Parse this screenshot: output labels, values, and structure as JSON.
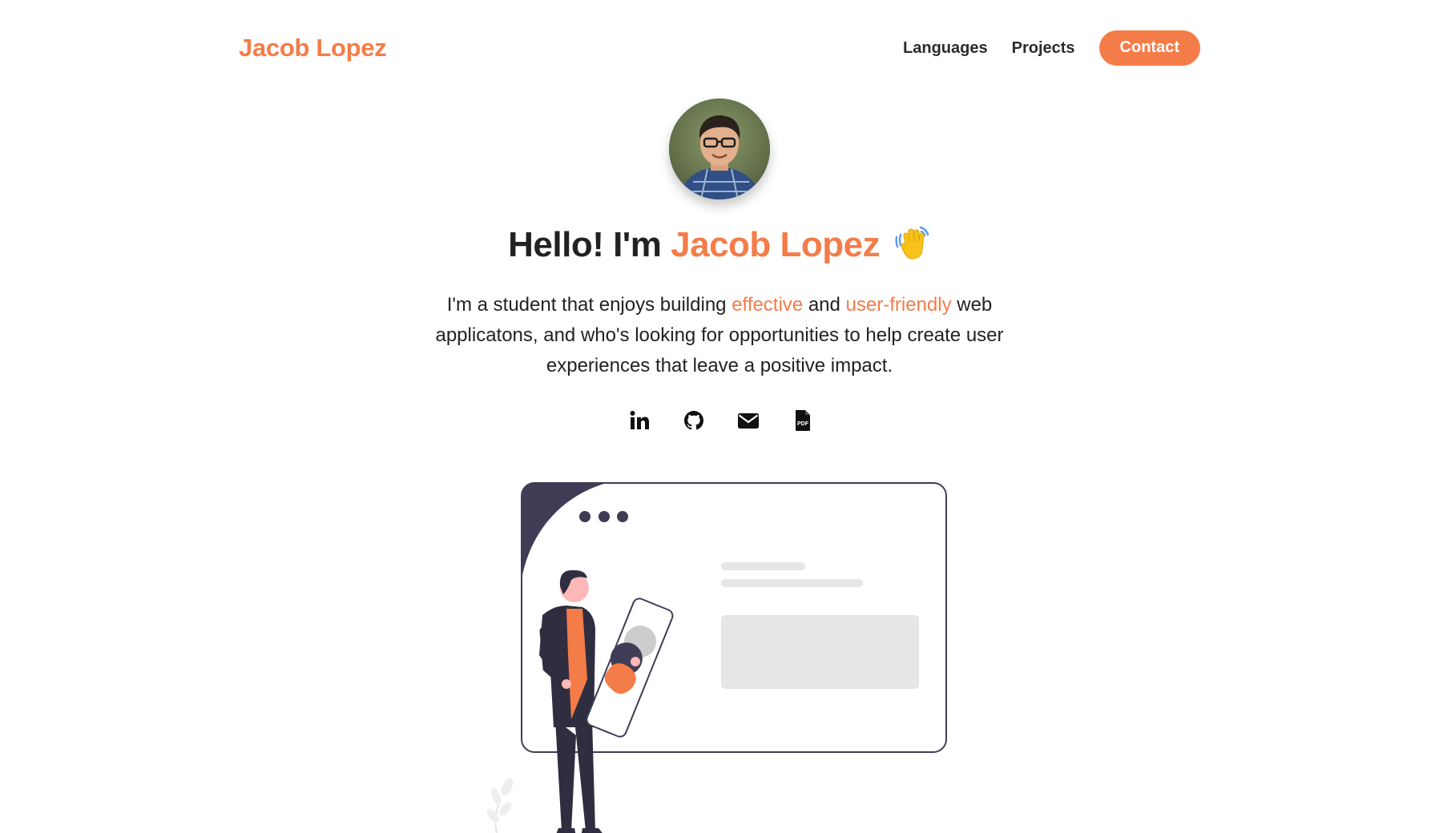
{
  "brand": {
    "name": "Jacob Lopez"
  },
  "nav": {
    "links": [
      {
        "label": "Languages"
      },
      {
        "label": "Projects"
      }
    ],
    "contact_label": "Contact"
  },
  "hero": {
    "greeting": "Hello! I'm",
    "name": "Jacob Lopez",
    "wave_icon": "waving-hand-emoji",
    "intro": {
      "part1": "I'm a student that enjoys building",
      "highlight1": "effective",
      "part2": "and",
      "highlight2": "user-friendly",
      "part3": "web applicatons, and who's looking for opportunities to help create user experiences that leave a positive impact."
    }
  },
  "socials": [
    {
      "icon": "linkedin-icon"
    },
    {
      "icon": "github-icon"
    },
    {
      "icon": "email-icon"
    },
    {
      "icon": "pdf-resume-icon"
    }
  ],
  "colors": {
    "accent": "#f47c48",
    "text": "#222222",
    "illustration_dark": "#3f3d56"
  }
}
